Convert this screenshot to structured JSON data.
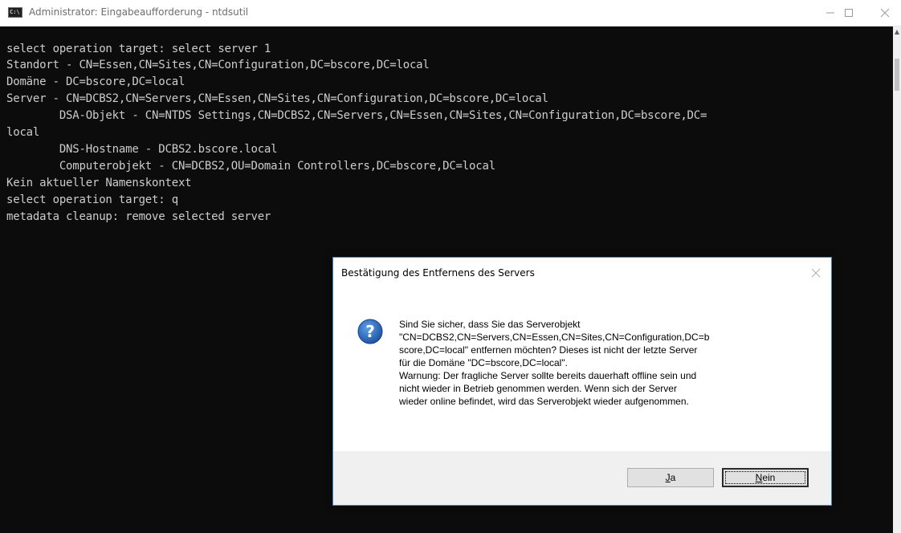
{
  "window": {
    "title": "Administrator: Eingabeaufforderung - ntdsutil",
    "icon_text": "C:\\",
    "icon": "console-app-icon",
    "controls": [
      "minimize-icon",
      "maximize-icon",
      "close-icon"
    ]
  },
  "console": {
    "lines": [
      "select operation target: select server 1",
      "Standort - CN=Essen,CN=Sites,CN=Configuration,DC=bscore,DC=local",
      "Domäne - DC=bscore,DC=local",
      "Server - CN=DCBS2,CN=Servers,CN=Essen,CN=Sites,CN=Configuration,DC=bscore,DC=local",
      "        DSA-Objekt - CN=NTDS Settings,CN=DCBS2,CN=Servers,CN=Essen,CN=Sites,CN=Configuration,DC=bscore,DC=",
      "local",
      "        DNS-Hostname - DCBS2.bscore.local",
      "        Computerobjekt - CN=DCBS2,OU=Domain Controllers,DC=bscore,DC=local",
      "Kein aktueller Namenskontext",
      "select operation target: q",
      "metadata cleanup: remove selected server"
    ]
  },
  "dialog": {
    "title": "Bestätigung des Entfernens des Servers",
    "icon": "question-icon",
    "message_lines": [
      "Sind Sie sicher, dass Sie das Serverobjekt",
      "\"CN=DCBS2,CN=Servers,CN=Essen,CN=Sites,CN=Configuration,DC=b",
      "score,DC=local\" entfernen möchten? Dieses ist nicht der letzte Server",
      "für die Domäne \"DC=bscore,DC=local\".",
      "Warnung: Der fragliche Server sollte bereits dauerhaft offline sein und",
      "nicht wieder in Betrieb genommen werden. Wenn sich der Server",
      "wieder online befindet, wird das Serverobjekt wieder aufgenommen."
    ],
    "buttons": {
      "yes": {
        "mnemonic": "J",
        "rest": "a"
      },
      "no": {
        "mnemonic": "N",
        "rest": "ein"
      }
    }
  },
  "colors": {
    "console_bg": "#0c0c0c",
    "console_fg": "#cccccc",
    "dialog_border": "#3f86d6",
    "question_icon": "#1f5fb4"
  }
}
